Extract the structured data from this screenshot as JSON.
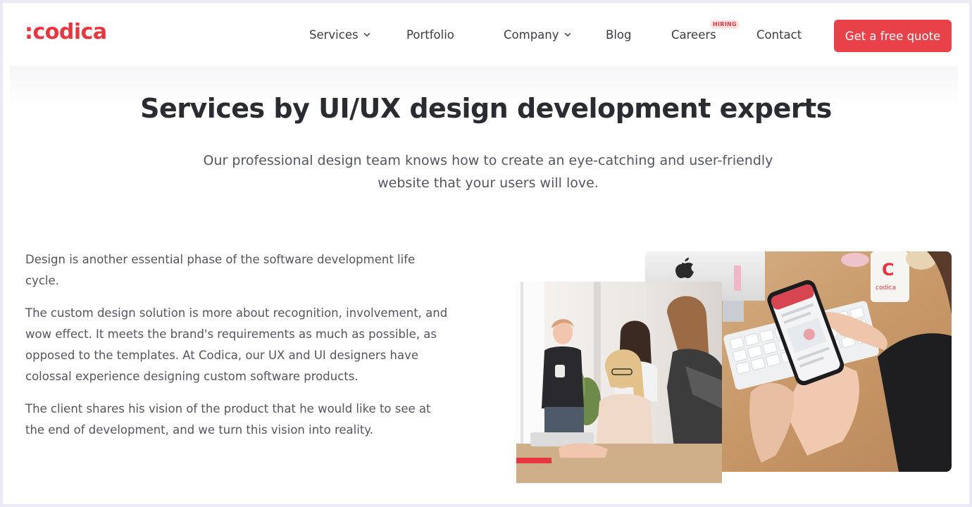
{
  "logo": ":codica",
  "nav": {
    "services": "Services",
    "portfolio": "Portfolio",
    "company": "Company",
    "blog": "Blog",
    "careers": "Careers",
    "hiring_badge": "HIRING",
    "contact": "Contact"
  },
  "cta_label": "Get a free quote",
  "hero": {
    "title": "Services by UI/UX design development experts",
    "subtitle": "Our professional design team knows how to create an eye-catching and user-friendly website that your users will love."
  },
  "body_paragraphs": [
    "Design is another essential phase of the software development life cycle.",
    "The custom design solution is more about recognition, involvement, and wow effect. It meets the brand's requirements as much as possible, as opposed to the templates. At Codica, our UX and UI designers have colossal experience designing custom software products.",
    "The client shares his vision of the product that he would like to see at the end of development, and we turn this vision into reality."
  ],
  "mug_logo": "codica",
  "colors": {
    "brand_red": "#e8363f",
    "cta_red": "#e8414a",
    "text_dark": "#2b2b32",
    "text_body": "#55555f",
    "page_border": "#ebe9f5"
  },
  "icons": [
    "chevron-down-icon"
  ]
}
